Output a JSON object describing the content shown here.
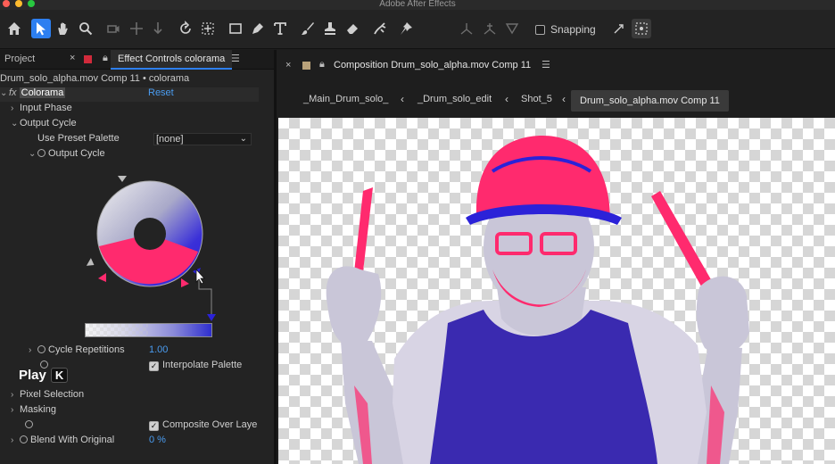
{
  "app": {
    "title": "Adobe After Effects"
  },
  "toolbar": {
    "tools": [
      "home-icon",
      "selection-tool-icon",
      "hand-tool-icon",
      "zoom-tool-icon",
      "orbit-camera-icon",
      "pan-camera-icon",
      "dolly-camera-icon",
      "rotation-tool-icon",
      "anchor-tool-icon",
      "rectangle-tool-icon",
      "pen-tool-icon",
      "type-tool-icon",
      "brush-tool-icon",
      "clone-stamp-icon",
      "eraser-tool-icon",
      "roto-brush-icon",
      "puppet-pin-icon",
      "axis-local-icon",
      "axis-world-icon",
      "axis-view-icon",
      "snap-edge-icon",
      "snap-grid-icon"
    ],
    "snapping_label": "Snapping"
  },
  "left_panel": {
    "tab_project": "Project",
    "tab_effect_controls": "Effect Controls colorama",
    "comp_label": "Drum_solo_alpha.mov Comp 11 • colorama",
    "effect": {
      "name": "Colorama",
      "reset": "Reset",
      "input_phase": "Input Phase",
      "output_cycle": "Output Cycle",
      "use_preset_palette_label": "Use Preset Palette",
      "use_preset_palette_value": "[none]",
      "output_cycle_sub": "Output Cycle",
      "cycle_repetitions_label": "Cycle Repetitions",
      "cycle_repetitions_value": "1.00",
      "interpolate_palette_label": "Interpolate Palette",
      "pixel_selection": "Pixel Selection",
      "masking": "Masking",
      "composite_over_layer_label": "Composite Over Laye",
      "blend_with_original_label": "Blend With Original",
      "blend_with_original_value": "0 %"
    },
    "play_hint": {
      "label": "Play",
      "key": "K"
    }
  },
  "composition_panel": {
    "title": "Composition Drum_solo_alpha.mov Comp 11",
    "breadcrumbs": [
      "_Main_Drum_solo_",
      "_Drum_solo_edit",
      "Shot_5",
      "Drum_solo_alpha.mov Comp 11"
    ]
  },
  "colors": {
    "accent": "#2d7ff0",
    "link": "#4a9cf0",
    "pink": "#ff1f6b",
    "blue": "#2b22d8"
  }
}
